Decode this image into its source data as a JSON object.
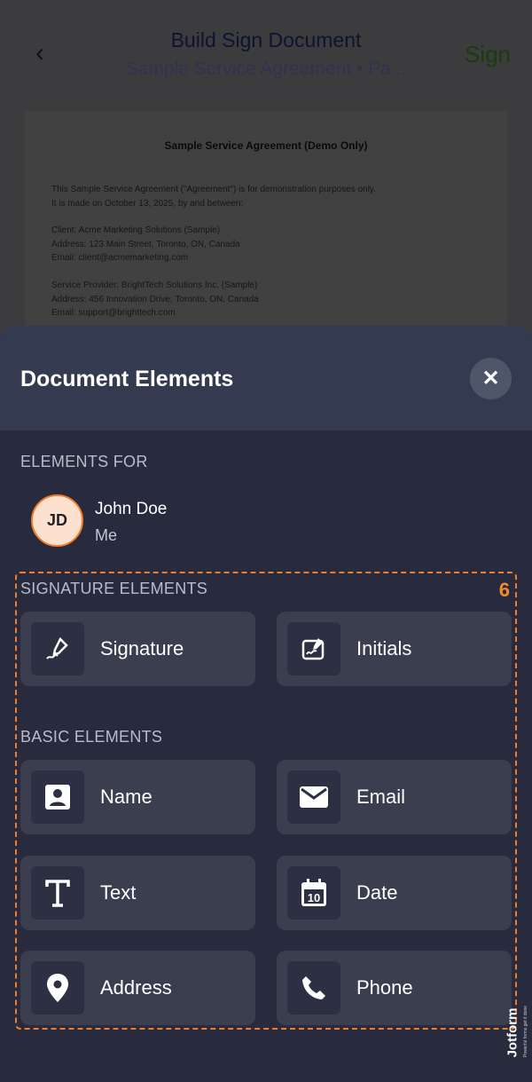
{
  "header": {
    "title": "Build Sign Document",
    "subtitle": "Sample Service Agreement • Pa...",
    "sign_label": "Sign"
  },
  "document": {
    "heading": "Sample Service Agreement (Demo Only)",
    "lines": [
      "This Sample Service Agreement (\"Agreement\") is for demonstration purposes only.",
      "It is made on October 13, 2025, by and between:",
      "Client: Acme Marketing Solutions (Sample)",
      "Address: 123 Main Street, Toronto, ON, Canada",
      "Email: client@acmemarketing.com",
      "Service Provider: BrightTech Solutions Inc. (Sample)",
      "Address: 456 Innovation Drive, Toronto, ON, Canada",
      "Email: support@brighttech.com"
    ]
  },
  "sheet": {
    "title": "Document Elements",
    "close_icon": "close-icon",
    "elements_for_label": "ELEMENTS FOR",
    "user": {
      "initials": "JD",
      "name": "John Doe",
      "role": "Me"
    },
    "badge": "6",
    "signature_section": "SIGNATURE ELEMENTS",
    "signature_items": [
      {
        "label": "Signature",
        "icon": "pen-sign-icon"
      },
      {
        "label": "Initials",
        "icon": "initials-icon"
      }
    ],
    "basic_section": "BASIC ELEMENTS",
    "basic_items": [
      {
        "label": "Name",
        "icon": "contact-icon"
      },
      {
        "label": "Email",
        "icon": "envelope-icon"
      },
      {
        "label": "Text",
        "icon": "text-icon"
      },
      {
        "label": "Date",
        "icon": "calendar-icon"
      },
      {
        "label": "Address",
        "icon": "location-pin-icon"
      },
      {
        "label": "Phone",
        "icon": "phone-icon"
      }
    ],
    "date_icon_number": "10"
  },
  "watermark": {
    "brand": "Jotform",
    "tagline": "Powerful forms get it done"
  },
  "colors": {
    "accent": "#f07d2c",
    "sign": "#1c3b0c"
  }
}
